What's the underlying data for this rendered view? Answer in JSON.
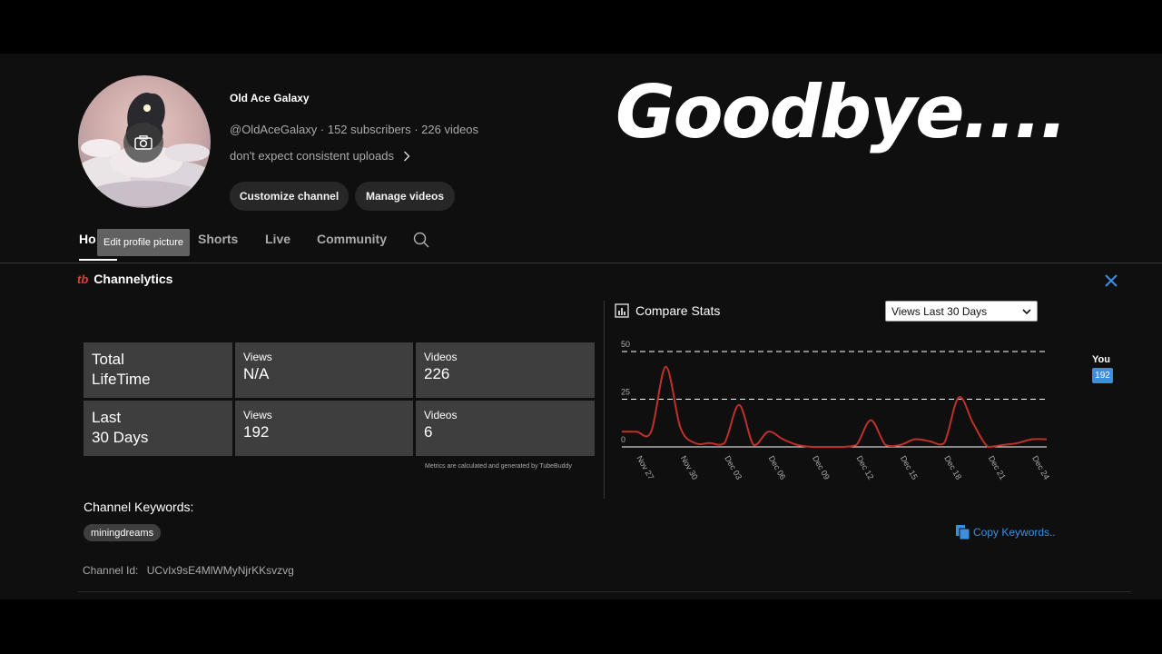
{
  "channel": {
    "name": "Old Ace Galaxy",
    "meta": "@OldAceGalaxy · 152 subscribers · 226 videos",
    "description": "don't expect consistent uploads",
    "customize_label": "Customize channel",
    "manage_label": "Manage videos",
    "avatar_icon": "camera-icon"
  },
  "overlay_text": "Goodbye....",
  "tabs": {
    "home": "Ho",
    "shorts": "Shorts",
    "live": "Live",
    "community": "Community",
    "tooltip": "Edit profile picture"
  },
  "channelytics": {
    "logo": "tb",
    "title": "Channelytics",
    "stats": {
      "total_label_1": "Total",
      "total_label_2": "LifeTime",
      "last_label_1": "Last",
      "last_label_2": "30 Days",
      "views_label": "Views",
      "videos_label": "Videos",
      "total_views": "N/A",
      "total_videos": "226",
      "last_views": "192",
      "last_videos": "6"
    },
    "metrics_note": "Metrics are calculated and generated by TubeBuddy",
    "compare_title": "Compare Stats",
    "select_value": "Views Last 30 Days",
    "legend_you": "You",
    "legend_value": "192",
    "keywords_label": "Channel Keywords:",
    "keywords": [
      "miningdreams"
    ],
    "copy_keywords": "Copy Keywords..",
    "channel_id_label": "Channel Id:",
    "channel_id": "UCvIx9sE4MlWMyNjrKKsvzvg"
  },
  "colors": {
    "accent_blue": "#3e8ee0",
    "line_red": "#c0302a",
    "tb_red": "#e63c2f"
  },
  "chart_data": {
    "type": "line",
    "x": [
      "Nov 26",
      "Nov 27",
      "Nov 28",
      "Nov 29",
      "Nov 30",
      "Dec 01",
      "Dec 02",
      "Dec 03",
      "Dec 04",
      "Dec 05",
      "Dec 06",
      "Dec 07",
      "Dec 08",
      "Dec 09",
      "Dec 10",
      "Dec 11",
      "Dec 12",
      "Dec 13",
      "Dec 14",
      "Dec 15",
      "Dec 16",
      "Dec 17",
      "Dec 18",
      "Dec 19",
      "Dec 20",
      "Dec 21",
      "Dec 22",
      "Dec 23",
      "Dec 24",
      "Dec 25"
    ],
    "tick_labels": [
      "Nov 27",
      "Nov 30",
      "Dec 03",
      "Dec 06",
      "Dec 09",
      "Dec 12",
      "Dec 15",
      "Dec 18",
      "Dec 21",
      "Dec 24"
    ],
    "series": [
      {
        "name": "You",
        "values": [
          8,
          8,
          8,
          42,
          10,
          2,
          2,
          2,
          22,
          1,
          8,
          4,
          1,
          0,
          0,
          0,
          1,
          14,
          1,
          1,
          4,
          3,
          2,
          26,
          12,
          0,
          1,
          2,
          4,
          4
        ]
      }
    ],
    "ylim": [
      0,
      50
    ],
    "yticks": [
      0,
      25,
      50
    ],
    "grid": true
  }
}
